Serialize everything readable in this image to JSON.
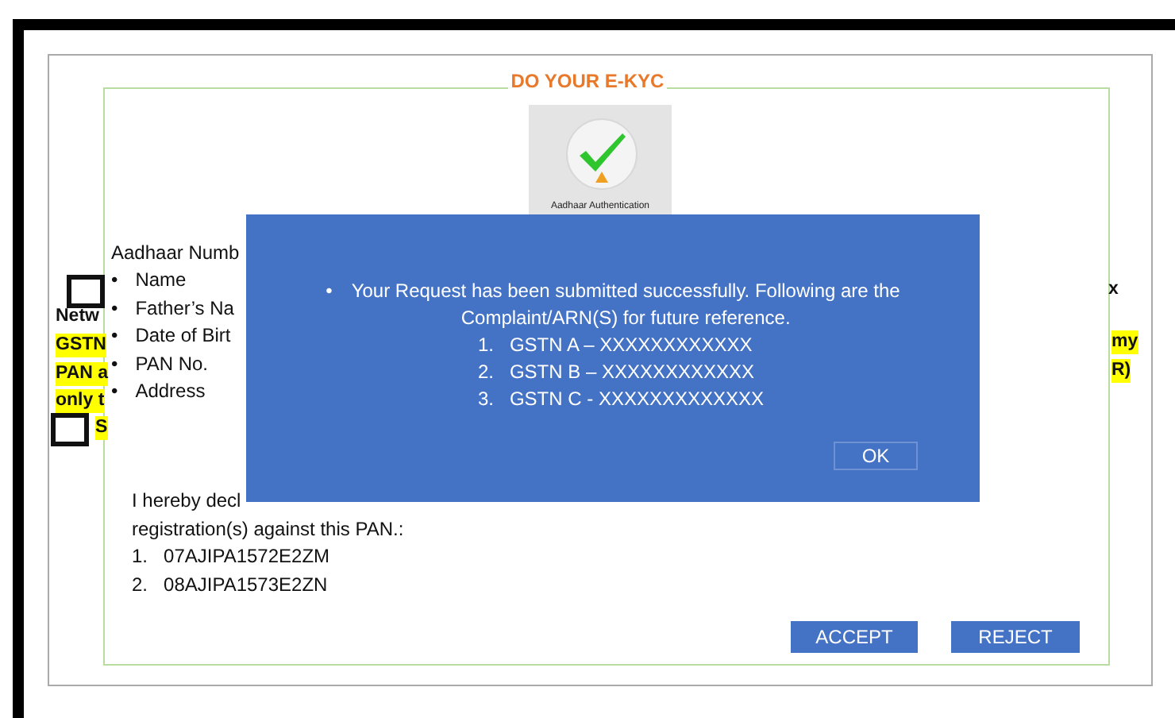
{
  "page_title": "DO YOUR E-KYC",
  "auth_badge": {
    "caption": "Aadhaar Authentication"
  },
  "left_fragments": [
    {
      "text": "Netw",
      "kind": "bold"
    },
    {
      "text": "GSTN",
      "kind": "highlight"
    },
    {
      "text": "PAN a",
      "kind": "highlight"
    },
    {
      "text": "only t",
      "kind": "highlight"
    },
    {
      "text": "S",
      "kind": "highlight"
    }
  ],
  "right_fragments": [
    {
      "text": "x",
      "kind": "bold"
    },
    {
      "text": "my",
      "kind": "highlight"
    },
    {
      "text": "R)",
      "kind": "highlight"
    }
  ],
  "checkboxes": [
    {
      "checked": false
    },
    {
      "checked": false
    }
  ],
  "details": {
    "heading": "Aadhaar Numb",
    "bullet": "•",
    "items": [
      "Name",
      "Father’s Na",
      "Date of Birt",
      "PAN No.",
      "Address"
    ]
  },
  "declaration": {
    "lines": [
      "I hereby decl",
      "registration(s) against this PAN.:"
    ],
    "registrations": [
      {
        "number": "1.",
        "text": "07AJIPA1572E2ZM"
      },
      {
        "number": "2.",
        "text": "08AJIPA1573E2ZN"
      }
    ]
  },
  "actions": [
    {
      "label": "ACCEPT"
    },
    {
      "label": "REJECT"
    }
  ],
  "dialog": {
    "bullet": "•",
    "message_lines": [
      "Your Request has been submitted successfully. Following are the",
      "Complaint/ARN(S) for future reference."
    ],
    "references": [
      {
        "number": "1.",
        "text": "GSTN A – XXXXXXXXXXXX"
      },
      {
        "number": "2.",
        "text": "GSTN B – XXXXXXXXXXXX"
      },
      {
        "number": "3.",
        "text": "GSTN C - XXXXXXXXXXXXX"
      }
    ],
    "button": "OK"
  }
}
